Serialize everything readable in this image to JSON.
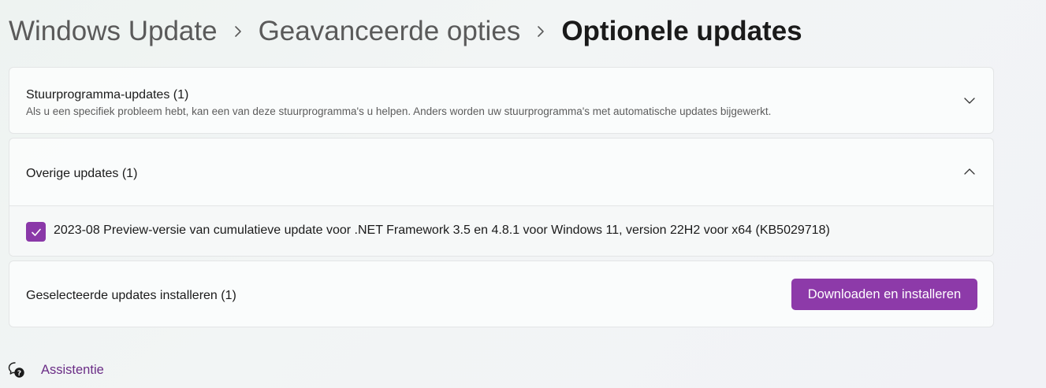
{
  "breadcrumb": {
    "items": [
      "Windows Update",
      "Geavanceerde opties"
    ],
    "current": "Optionele updates"
  },
  "driver_updates": {
    "title": "Stuurprogramma-updates (1)",
    "description": "Als u een specifiek probleem hebt, kan een van deze stuurprogramma's u helpen. Anders worden uw stuurprogramma's met automatische updates bijgewerkt.",
    "expanded": false,
    "icon": "chevron-down-icon"
  },
  "other_updates": {
    "title": "Overige updates (1)",
    "expanded": true,
    "icon": "chevron-up-icon",
    "items": [
      {
        "label": "2023-08 Preview-versie van cumulatieve update voor .NET Framework 3.5 en 4.8.1 voor Windows 11, version 22H2 voor x64 (KB5029718)",
        "checked": true
      }
    ]
  },
  "install": {
    "label": "Geselecteerde updates installeren (1)",
    "button_label": "Downloaden en installeren"
  },
  "help": {
    "label": "Assistentie",
    "icon": "get-help-icon"
  },
  "colors": {
    "accent": "#8d3aa9",
    "link": "#6b2d86"
  }
}
